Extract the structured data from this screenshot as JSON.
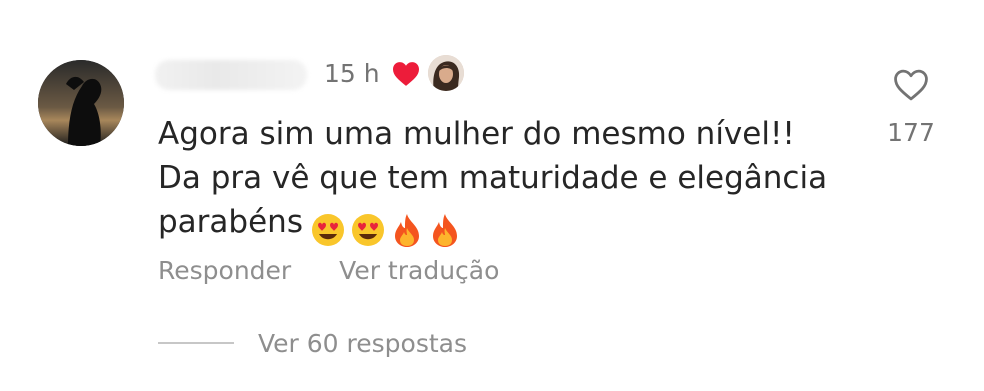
{
  "comment": {
    "time": "15 h",
    "text_lines": [
      "Agora sim uma mulher do mesmo nível!!",
      "Da pra vê que tem maturidade e elegância",
      "parabéns"
    ],
    "emojis": [
      "heart-eyes-emoji",
      "heart-eyes-emoji",
      "fire-emoji",
      "fire-emoji"
    ],
    "like_count": "177",
    "liked_by_author": true,
    "actions": {
      "reply": "Responder",
      "translate": "Ver tradução"
    },
    "replies_label": "Ver 60 respostas"
  },
  "colors": {
    "text": "#262626",
    "secondary": "#8e8e8e",
    "heart_red": "#ed4956"
  }
}
